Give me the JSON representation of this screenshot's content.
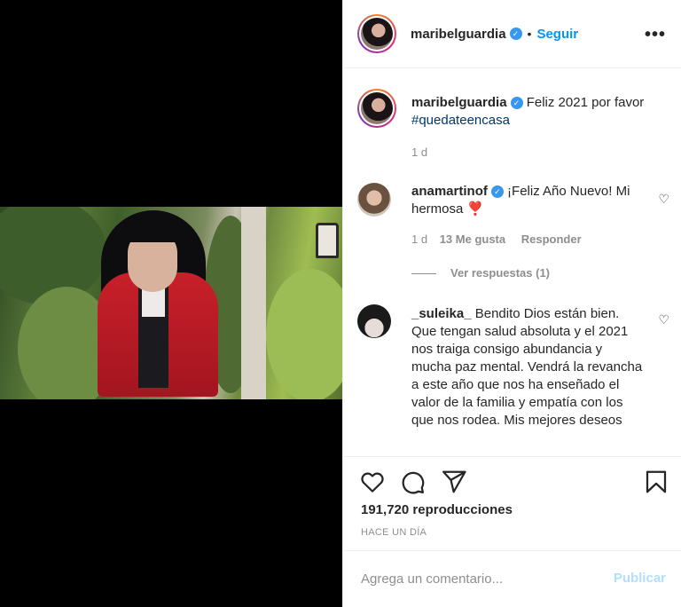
{
  "post": {
    "username": "maribelguardia",
    "follow_label": "Seguir",
    "dot": "•",
    "more": "•••",
    "caption": "Feliz 2021 por favor",
    "hashtag": "#quedateencasa",
    "caption_time": "1 d"
  },
  "comments": [
    {
      "username": "anamartinof",
      "text": "¡Feliz Año Nuevo! Mi hermosa",
      "emoji": "❣️",
      "time": "1 d",
      "likes": "13 Me gusta",
      "reply_label": "Responder",
      "view_replies": "Ver respuestas (1)"
    },
    {
      "username": "_suleika_",
      "text": "Bendito Dios están bien. Que tengan salud absoluta y el 2021 nos traiga consigo abundancia y mucha paz mental. Vendrá la revancha a este año que nos ha enseñado el valor de la familia y empatía con los que nos rodea. Mis mejores deseos"
    }
  ],
  "stats": {
    "views": "191,720 reproducciones",
    "ago": "HACE UN DÍA"
  },
  "composer": {
    "placeholder": "Agrega un comentario...",
    "publish_label": "Publicar"
  },
  "icons": {
    "like": "heart-icon",
    "comment": "comment-icon",
    "share": "send-icon",
    "save": "bookmark-icon",
    "verified": "verified-badge-icon"
  },
  "colors": {
    "accent": "#0095f6",
    "verified": "#3897f0",
    "publish_disabled": "#b2dffc"
  }
}
